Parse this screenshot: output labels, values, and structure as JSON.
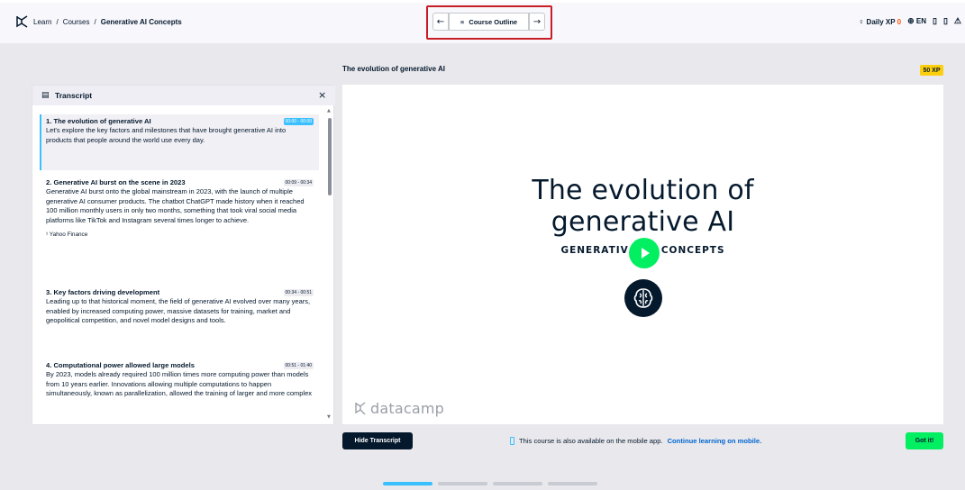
{
  "header": {
    "breadcrumb": [
      "Learn",
      "/",
      "Courses",
      "/",
      "Generative AI Concepts"
    ],
    "nav": {
      "prev_icon": "←",
      "outline_label": "Course Outline",
      "outline_icon": "≡",
      "next_icon": "→"
    },
    "daily_xp_label": "Daily XP",
    "daily_xp_value": "0",
    "language": "EN"
  },
  "lesson": {
    "title": "The evolution of generative AI",
    "xp_badge": "50 XP"
  },
  "transcript": {
    "title": "Transcript",
    "close_icon": "×",
    "segments": [
      {
        "title": "1. The evolution of generative AI",
        "time": "00:00 - 00:09",
        "text": "Let's explore the key factors and milestones that have brought generative AI into products that people around the world use every day.",
        "note": ""
      },
      {
        "title": "2. Generative AI burst on the scene in 2023",
        "time": "00:09 - 00:34",
        "text": "Generative AI burst onto the global mainstream in 2023, with the launch of multiple generative AI consumer products. The chatbot ChatGPT made history when it reached 100 million monthly users in only two months, something that took viral social media platforms like TikTok and Instagram several times longer to achieve.",
        "note": "¹ Yahoo Finance"
      },
      {
        "title": "3. Key factors driving development",
        "time": "00:34 - 00:51",
        "text": "Leading up to that historical moment, the field of generative AI evolved over many years, enabled by increased computing power, massive datasets for training, market and geopolitical competition, and novel model designs and tools.",
        "note": ""
      },
      {
        "title": "4. Computational power allowed large models",
        "time": "00:51 - 01:40",
        "text": "By 2023, models already required 100 million times more computing power than models from 10 years earlier. Innovations allowing multiple computations to happen simultaneously, known as parallelization, allowed the training of larger and more complex",
        "note": ""
      }
    ]
  },
  "video": {
    "title_line1": "The evolution of",
    "title_line2": "generative AI",
    "subtitle_left": "GENERATIV",
    "subtitle_right": "CONCEPTS",
    "watermark": "datacamp"
  },
  "footer": {
    "hide_transcript": "Hide Transcript",
    "mobile_text": "This course is also available on the mobile app.",
    "mobile_link": "Continue learning on mobile.",
    "got_it": "Got it!"
  },
  "progress": {
    "current_step": 1,
    "total_steps": 4
  },
  "colors": {
    "accent_green": "#03ef62",
    "active_blue": "#3ac0ff",
    "xp_orange": "#ff5400",
    "xp_badge": "#fcce0d",
    "highlight_red": "#c81d25"
  }
}
